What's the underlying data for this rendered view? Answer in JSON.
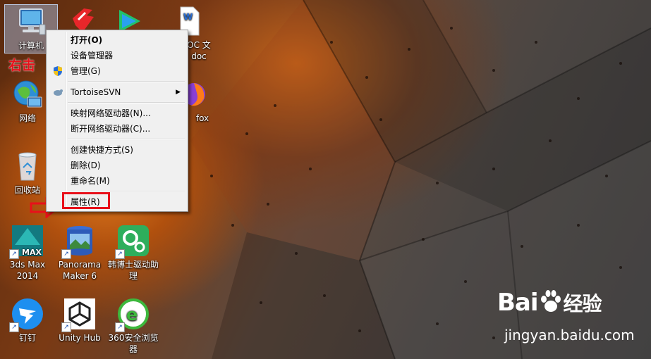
{
  "annotation": {
    "right_click_label": "右击"
  },
  "desktop_icons": {
    "computer": {
      "label": "计算机"
    },
    "network": {
      "label": "网络"
    },
    "recycle_bin": {
      "label": "回收站"
    },
    "doc_file": {
      "label_line1": "OC 文",
      "label_line2": "doc"
    },
    "firefox": {
      "label": "fox"
    },
    "max": {
      "label_line1": "3ds Max",
      "label_line2": "2014"
    },
    "panorama": {
      "label_line1": "Panorama",
      "label_line2": "Maker 6"
    },
    "driver": {
      "label_line1": "韩博士驱动助",
      "label_line2": "理"
    },
    "dingtalk": {
      "label": "钉钉"
    },
    "unity": {
      "label": "Unity Hub"
    },
    "browser360": {
      "label_line1": "360安全浏览",
      "label_line2": "器"
    }
  },
  "context_menu": {
    "open": "打开(O)",
    "device_manager": "设备管理器",
    "manage": "管理(G)",
    "tortoise": "TortoiseSVN",
    "map_drive": "映射网络驱动器(N)...",
    "disconnect_drive": "断开网络驱动器(C)...",
    "create_shortcut": "创建快捷方式(S)",
    "delete": "删除(D)",
    "rename": "重命名(M)",
    "properties": "属性(R)"
  },
  "watermark": {
    "brand": "Bai",
    "brand2": "经验",
    "url": "jingyan.baidu.com"
  },
  "colors": {
    "annotation_red": "#e8101a",
    "menu_bg": "#f0f0f0"
  }
}
